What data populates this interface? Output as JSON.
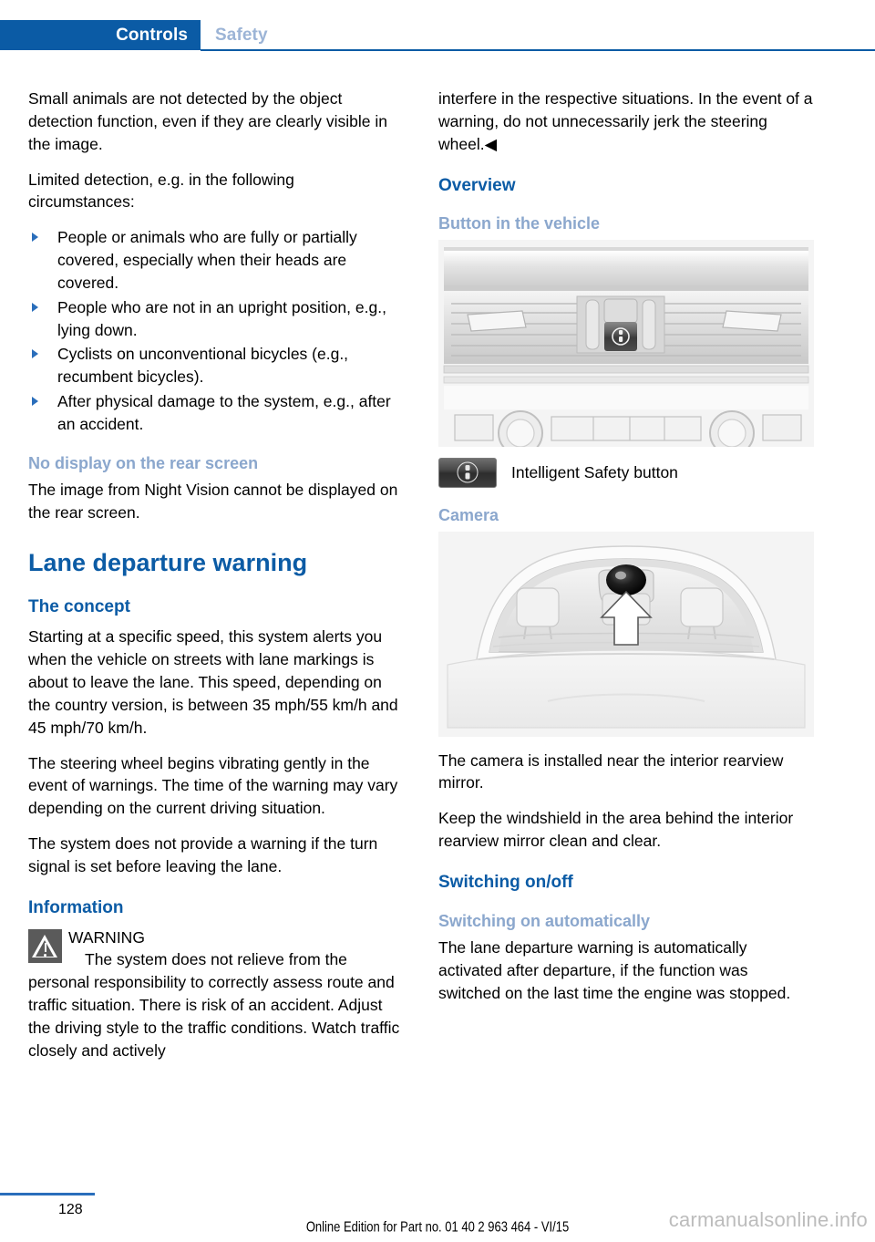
{
  "header": {
    "active_tab": "Controls",
    "inactive_tab": "Safety",
    "accent_color": "#0b5ba5",
    "inactive_color": "#9cb4d6"
  },
  "left_column": {
    "p1": "Small animals are not detected by the object detection function, even if they are clearly visible in the image.",
    "p2": "Limited detection, e.g. in the following circumstances:",
    "bullets": [
      "People or animals who are fully or partially covered, especially when their heads are covered.",
      "People who are not in an upright position, e.g., lying down.",
      "Cyclists on unconventional bicycles (e.g., recumbent bicycles).",
      "After physical damage to the system, e.g., after an accident."
    ],
    "h3_no_display": "No display on the rear screen",
    "p3": "The image from Night Vision cannot be displayed on the rear screen.",
    "h1_lane": "Lane departure warning",
    "h3_concept": "The concept",
    "p4": "Starting at a specific speed, this system alerts you when the vehicle on streets with lane markings is about to leave the lane. This speed, depending on the country version, is between 35 mph/55 km/h and 45 mph/70 km/h.",
    "p5": "The steering wheel begins vibrating gently in the event of warnings. The time of the warning may vary depending on the current driving situation.",
    "p6": "The system does not provide a warning if the turn signal is set before leaving the lane.",
    "h2_information": "Information",
    "warning_title": "WARNING",
    "warning_body": "The system does not relieve from the personal responsibility to correctly assess route and traffic situation. There is risk of an accident. Adjust the driving style to the traffic conditions. Watch traffic closely and actively"
  },
  "right_column": {
    "p1": "interfere in the respective situations. In the event of a warning, do not unnecessarily jerk the steering wheel.◀",
    "h2_overview": "Overview",
    "h3_button": "Button in the vehicle",
    "figure_console_alt": "Center console with air vents and Intelligent Safety button",
    "caption_button": "Intelligent Safety button",
    "h3_camera": "Camera",
    "figure_camera_alt": "Vehicle windshield with arrow pointing to camera near interior rearview mirror",
    "p2": "The camera is installed near the interior rearview mirror.",
    "p3": "Keep the windshield in the area behind the interior rearview mirror clean and clear.",
    "h2_switching": "Switching on/off",
    "h3_switching_auto": "Switching on automatically",
    "p4": "The lane departure warning is automatically activated after departure, if the function was switched on the last time the engine was stopped."
  },
  "footer": {
    "page_number": "128",
    "edition_line": "Online Edition for Part no. 01 40 2 963 464 - VI/15",
    "watermark": "carmanualsonline.info"
  }
}
